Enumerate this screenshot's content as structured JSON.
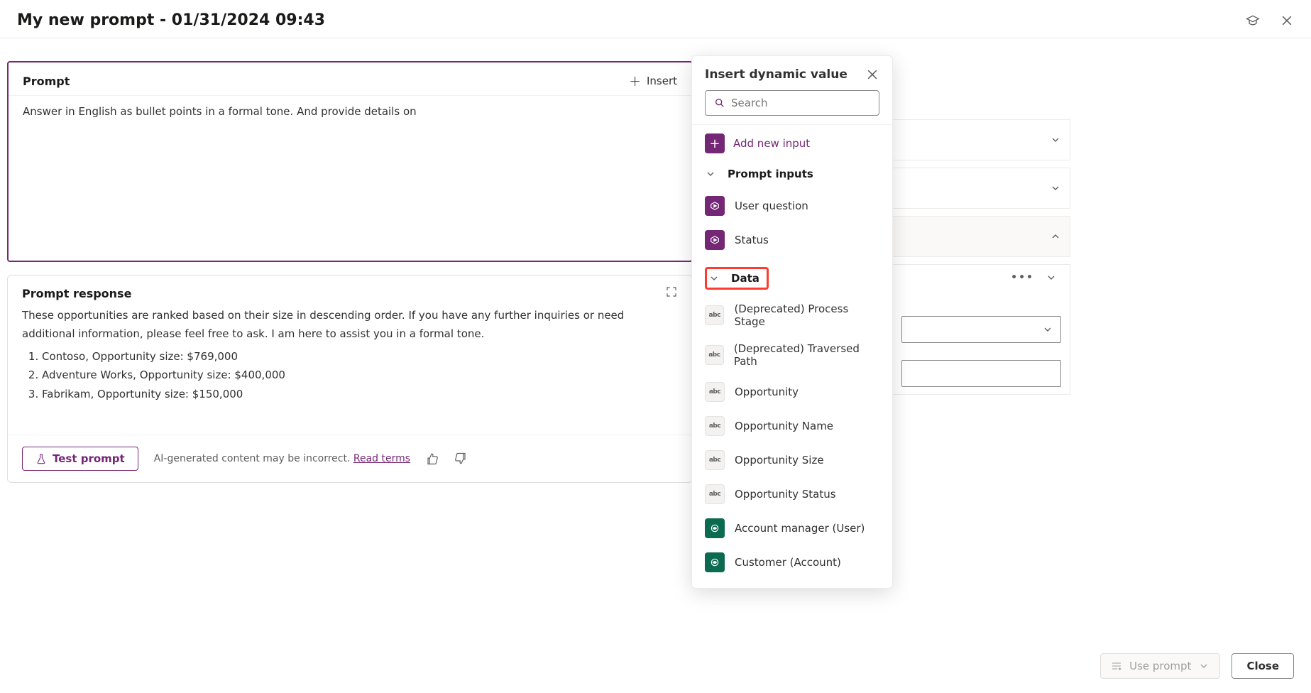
{
  "header": {
    "title": "My new prompt - 01/31/2024 09:43"
  },
  "prompt_card": {
    "title": "Prompt",
    "insert_label": "Insert",
    "text": "Answer in English as bullet points in a formal tone. And provide details on"
  },
  "response_card": {
    "title": "Prompt response",
    "intro": "These opportunities are ranked based on their size in descending order. If you have any further inquiries or need additional information, please feel free to ask. I am here to assist you in a formal tone.",
    "items": [
      "Contoso, Opportunity size: $769,000",
      "Adventure Works, Opportunity size: $400,000",
      "Fabrikam, Opportunity size: $150,000"
    ],
    "test_label": "Test prompt",
    "disclaimer": "AI-generated content may be incorrect.",
    "read_terms": "Read terms"
  },
  "popover": {
    "title": "Insert dynamic value",
    "search_placeholder": "Search",
    "add_new_label": "Add new input",
    "group_prompt_inputs": "Prompt inputs",
    "prompt_inputs": [
      {
        "label": "User question"
      },
      {
        "label": "Status"
      }
    ],
    "group_data": "Data",
    "data_items": [
      {
        "label": "(Deprecated) Process Stage",
        "icon": "grey"
      },
      {
        "label": "(Deprecated) Traversed Path",
        "icon": "grey"
      },
      {
        "label": "Opportunity",
        "icon": "grey"
      },
      {
        "label": "Opportunity Name",
        "icon": "grey"
      },
      {
        "label": "Opportunity Size",
        "icon": "grey"
      },
      {
        "label": "Opportunity Status",
        "icon": "grey"
      },
      {
        "label": "Account manager (User)",
        "icon": "green"
      },
      {
        "label": "Customer (Account)",
        "icon": "green"
      }
    ]
  },
  "bottom": {
    "use_prompt": "Use prompt",
    "close": "Close"
  }
}
